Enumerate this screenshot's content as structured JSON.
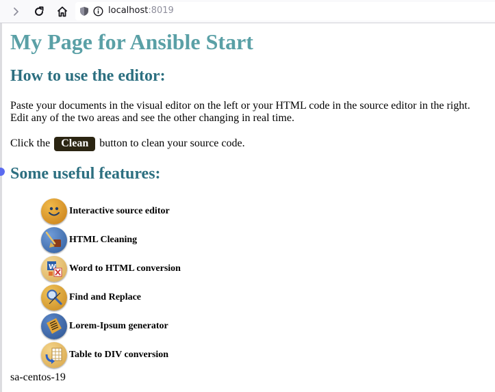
{
  "browser": {
    "url_host": "localhost",
    "url_port": ":8019"
  },
  "page": {
    "title": "My Page for Ansible Start",
    "how_to_heading": "How to use the editor:",
    "how_to_text": "Paste your documents in the visual editor on the left or your HTML code in the source editor in the right. Edit any of the two areas and see the other changing in real time.",
    "click_before": "Click the",
    "clean_label": "Clean",
    "click_after": "button to clean your source code.",
    "features_heading": "Some useful features:",
    "features": [
      {
        "label": "Interactive source editor",
        "icon": "smiley-face-icon"
      },
      {
        "label": "HTML Cleaning",
        "icon": "broom-icon"
      },
      {
        "label": "Word to HTML conversion",
        "icon": "word-document-icon"
      },
      {
        "label": "Find and Replace",
        "icon": "magnifier-icon"
      },
      {
        "label": "Lorem-Ipsum generator",
        "icon": "lorem-text-icon"
      },
      {
        "label": "Table to DIV conversion",
        "icon": "table-convert-icon"
      }
    ],
    "footer_host": "sa-centos-19"
  }
}
